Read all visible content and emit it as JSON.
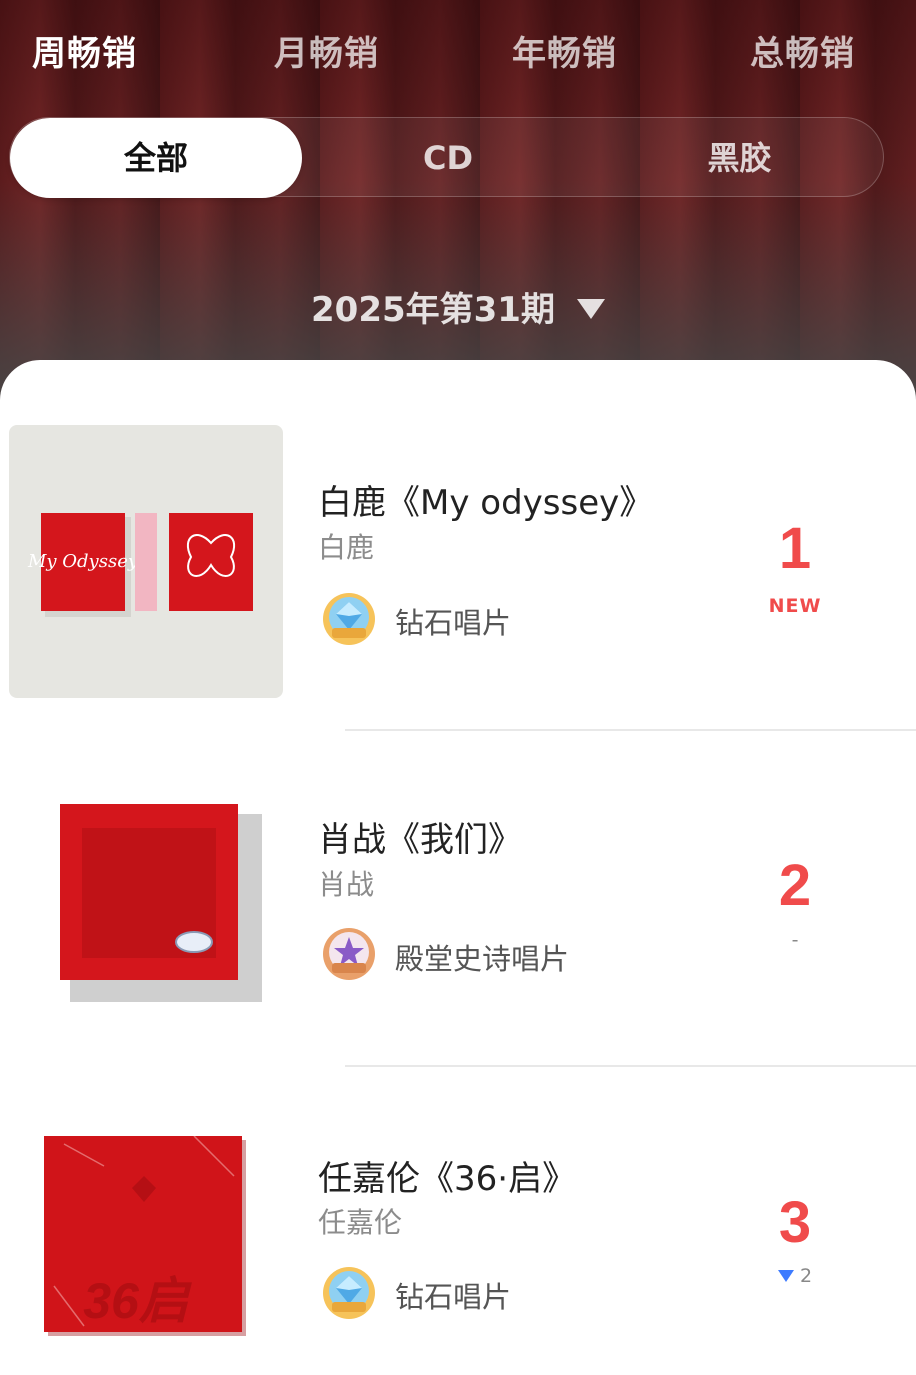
{
  "header": {
    "tabs": [
      {
        "label": "周畅销",
        "active": true
      },
      {
        "label": "月畅销",
        "active": false
      },
      {
        "label": "年畅销",
        "active": false
      },
      {
        "label": "总畅销",
        "active": false
      }
    ],
    "segments": [
      {
        "label": "全部",
        "active": true
      },
      {
        "label": "CD",
        "active": false
      },
      {
        "label": "黑胶",
        "active": false
      }
    ],
    "period": "2025年第31期"
  },
  "chart": [
    {
      "title": "白鹿《My odyssey》",
      "artist": "白鹿",
      "badge": "钻石唱片",
      "badge_icon": "diamond-record-badge",
      "rank": "1",
      "trend": "NEW",
      "trend_type": "new"
    },
    {
      "title": "肖战《我们》",
      "artist": "肖战",
      "badge": "殿堂史诗唱片",
      "badge_icon": "hall-of-fame-epic-badge",
      "rank": "2",
      "trend": "-",
      "trend_type": "same"
    },
    {
      "title": "任嘉伦《36·启》",
      "artist": "任嘉伦",
      "badge": "钻石唱片",
      "badge_icon": "diamond-record-badge",
      "rank": "3",
      "trend": "2",
      "trend_type": "down"
    }
  ],
  "covers": {
    "c1_text": "My Odyssey",
    "c3_text": "36启"
  },
  "colors": {
    "accent_red": "#f04b4b",
    "trend_down_blue": "#3d7bff",
    "album_red": "#d4161c"
  }
}
